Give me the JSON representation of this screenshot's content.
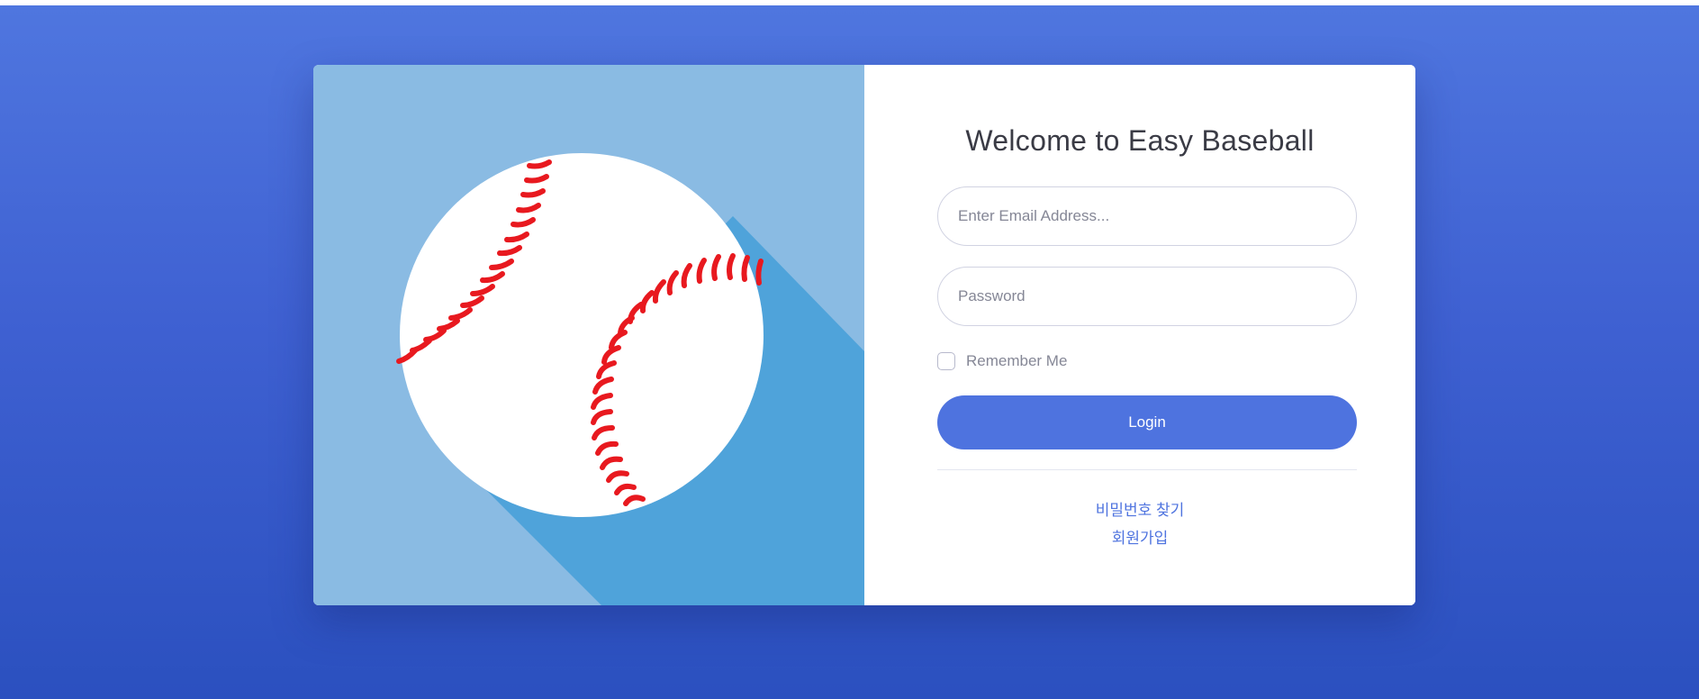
{
  "login": {
    "title": "Welcome to Easy Baseball",
    "email_placeholder": "Enter Email Address...",
    "password_placeholder": "Password",
    "remember_label": "Remember Me",
    "login_label": "Login",
    "find_password_link": "비밀번호 찾기",
    "signup_link": "회원가입"
  },
  "colors": {
    "background_top": "#4f76df",
    "background_bottom": "#2b50bf",
    "image_panel": "#8abbe3",
    "ball_shadow": "#4fa3da",
    "ball": "#ffffff",
    "stitches": "#e8191f",
    "primary": "#4e73df",
    "title_text": "#3a3b45"
  },
  "icons": {
    "hero_image": "baseball-icon",
    "remember_checkbox": "checkbox-unchecked"
  }
}
